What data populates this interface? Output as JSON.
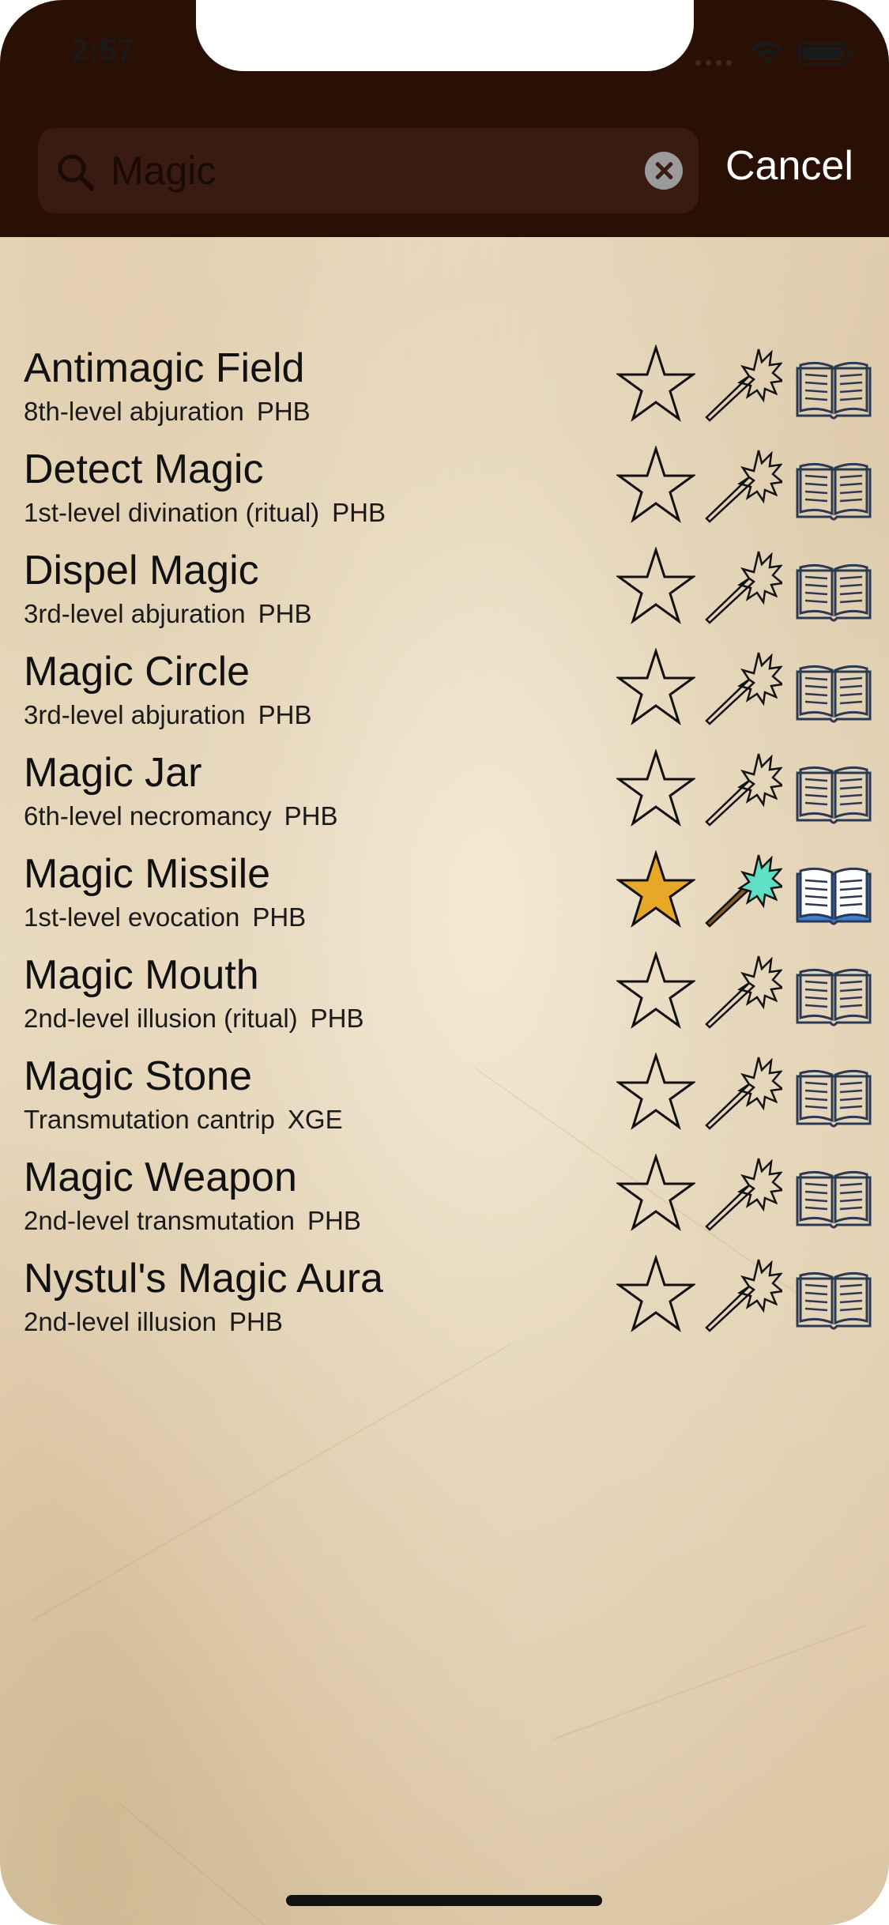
{
  "status_bar": {
    "time": "2:57"
  },
  "search": {
    "value": "Magic",
    "cancel_label": "Cancel"
  },
  "colors": {
    "header_bg": "#2a0f05",
    "favorite_active": "#e8a827",
    "prepared_active": "#5fe0c4",
    "known_active": "#3a7fd0"
  },
  "spells": [
    {
      "name": "Antimagic Field",
      "level": "8th-level abjuration",
      "source": "PHB",
      "favorite": false,
      "prepared": false,
      "known": false
    },
    {
      "name": "Detect Magic",
      "level": "1st-level divination (ritual)",
      "source": "PHB",
      "favorite": false,
      "prepared": false,
      "known": false
    },
    {
      "name": "Dispel Magic",
      "level": "3rd-level abjuration",
      "source": "PHB",
      "favorite": false,
      "prepared": false,
      "known": false
    },
    {
      "name": "Magic Circle",
      "level": "3rd-level abjuration",
      "source": "PHB",
      "favorite": false,
      "prepared": false,
      "known": false
    },
    {
      "name": "Magic Jar",
      "level": "6th-level necromancy",
      "source": "PHB",
      "favorite": false,
      "prepared": false,
      "known": false
    },
    {
      "name": "Magic Missile",
      "level": "1st-level evocation",
      "source": "PHB",
      "favorite": true,
      "prepared": true,
      "known": true
    },
    {
      "name": "Magic Mouth",
      "level": "2nd-level illusion (ritual)",
      "source": "PHB",
      "favorite": false,
      "prepared": false,
      "known": false
    },
    {
      "name": "Magic Stone",
      "level": "Transmutation cantrip",
      "source": "XGE",
      "favorite": false,
      "prepared": false,
      "known": false
    },
    {
      "name": "Magic Weapon",
      "level": "2nd-level transmutation",
      "source": "PHB",
      "favorite": false,
      "prepared": false,
      "known": false
    },
    {
      "name": "Nystul's Magic Aura",
      "level": "2nd-level illusion",
      "source": "PHB",
      "favorite": false,
      "prepared": false,
      "known": false
    }
  ]
}
